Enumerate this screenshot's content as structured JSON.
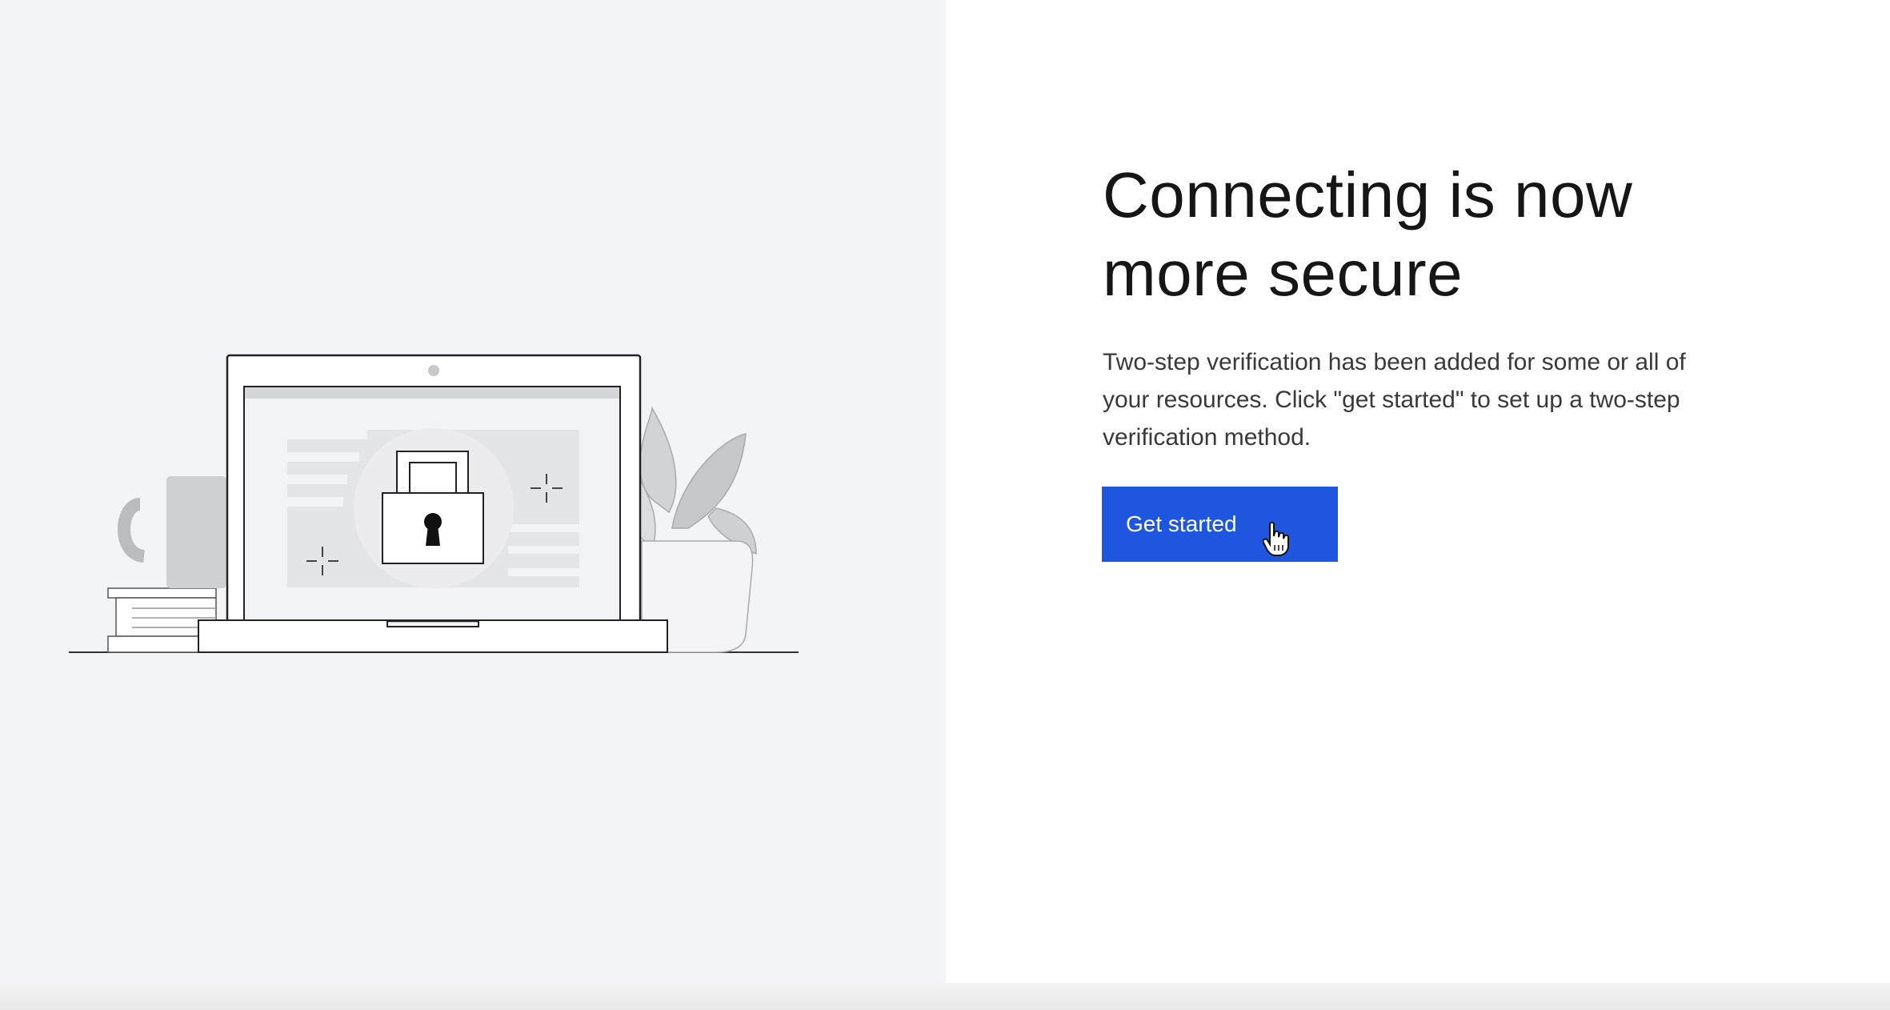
{
  "main": {
    "headline": "Connecting is now\nmore secure",
    "description": "Two-step verification has been added for some or all of your resources. Click \"get started\" to set up a two-step verification method.",
    "cta_label": "Get started"
  },
  "icons": {
    "illustration": "laptop-lock-illustration",
    "cursor": "hand-pointer-cursor"
  },
  "colors": {
    "accent": "#1f56df",
    "left_background": "#f2f4f8",
    "heading_text": "#161616",
    "body_text": "#393939"
  }
}
